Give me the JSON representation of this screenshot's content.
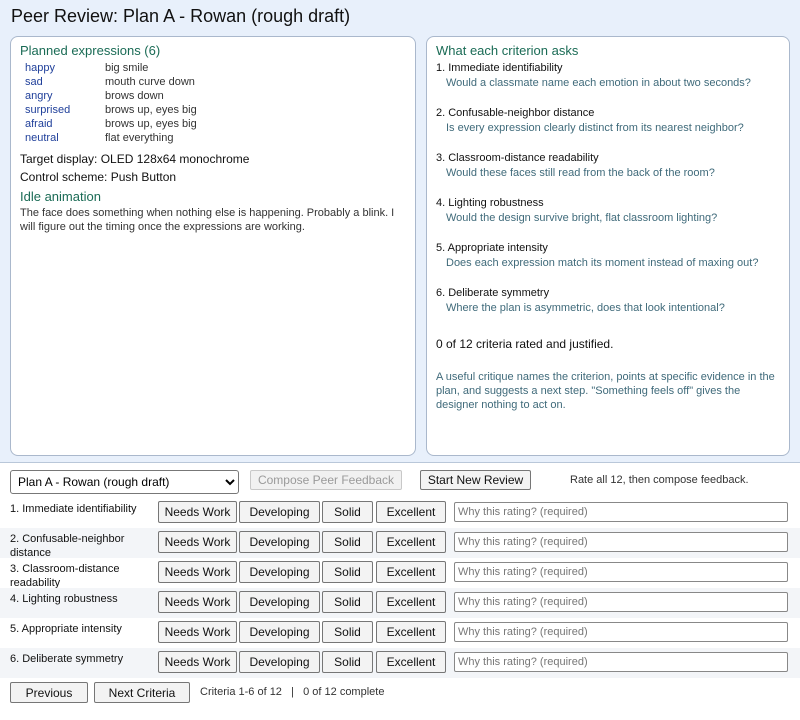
{
  "title": "Peer Review: Plan A - Rowan (rough draft)",
  "plan": {
    "expressions_title": "Planned expressions (6)",
    "expressions": [
      {
        "name": "happy",
        "desc": "big smile"
      },
      {
        "name": "sad",
        "desc": "mouth curve down"
      },
      {
        "name": "angry",
        "desc": "brows down"
      },
      {
        "name": "surprised",
        "desc": "brows up, eyes big"
      },
      {
        "name": "afraid",
        "desc": "brows up, eyes big"
      },
      {
        "name": "neutral",
        "desc": "flat everything"
      }
    ],
    "target_display": "Target display: OLED 128x64 monochrome",
    "control_scheme": "Control scheme: Push Button",
    "idle_title": "Idle animation",
    "idle_text": "The face does something when nothing else is happening. Probably a blink. I will figure out the timing once the expressions are working."
  },
  "criteria_panel": {
    "title": "What each criterion asks",
    "items": [
      {
        "title": "1. Immediate identifiability",
        "question": "Would a classmate name each emotion in about two seconds?"
      },
      {
        "title": "2. Confusable-neighbor distance",
        "question": "Is every expression clearly distinct from its nearest neighbor?"
      },
      {
        "title": "3. Classroom-distance readability",
        "question": "Would these faces still read from the back of the room?"
      },
      {
        "title": "4. Lighting robustness",
        "question": "Would the design survive bright, flat classroom lighting?"
      },
      {
        "title": "5. Appropriate intensity",
        "question": "Does each expression match its moment instead of maxing out?"
      },
      {
        "title": "6. Deliberate symmetry",
        "question": "Where the plan is asymmetric, does that look intentional?"
      }
    ],
    "status": "0 of 12 criteria rated and justified.",
    "hint": "A useful critique names the criterion, points at specific evidence in the plan, and suggests a next step. \"Something feels off\" gives the designer nothing to act on."
  },
  "toolbar": {
    "plan_selected": "Plan A - Rowan (rough draft)",
    "compose_label": "Compose Peer Feedback",
    "start_new_label": "Start New Review",
    "note": "Rate all 12, then compose feedback."
  },
  "rating_options": [
    "Needs Work",
    "Developing",
    "Solid",
    "Excellent"
  ],
  "why_placeholder": "Why this rating? (required)",
  "rows": [
    {
      "label": "1. Immediate identifiability"
    },
    {
      "label": "2. Confusable-neighbor distance"
    },
    {
      "label": "3. Classroom-distance readability"
    },
    {
      "label": "4. Lighting robustness"
    },
    {
      "label": "5. Appropriate intensity"
    },
    {
      "label": "6. Deliberate symmetry"
    }
  ],
  "footer": {
    "previous_label": "Previous",
    "next_label": "Next Criteria",
    "info": "Criteria 1-6 of 12   |   0 of 12 complete"
  }
}
